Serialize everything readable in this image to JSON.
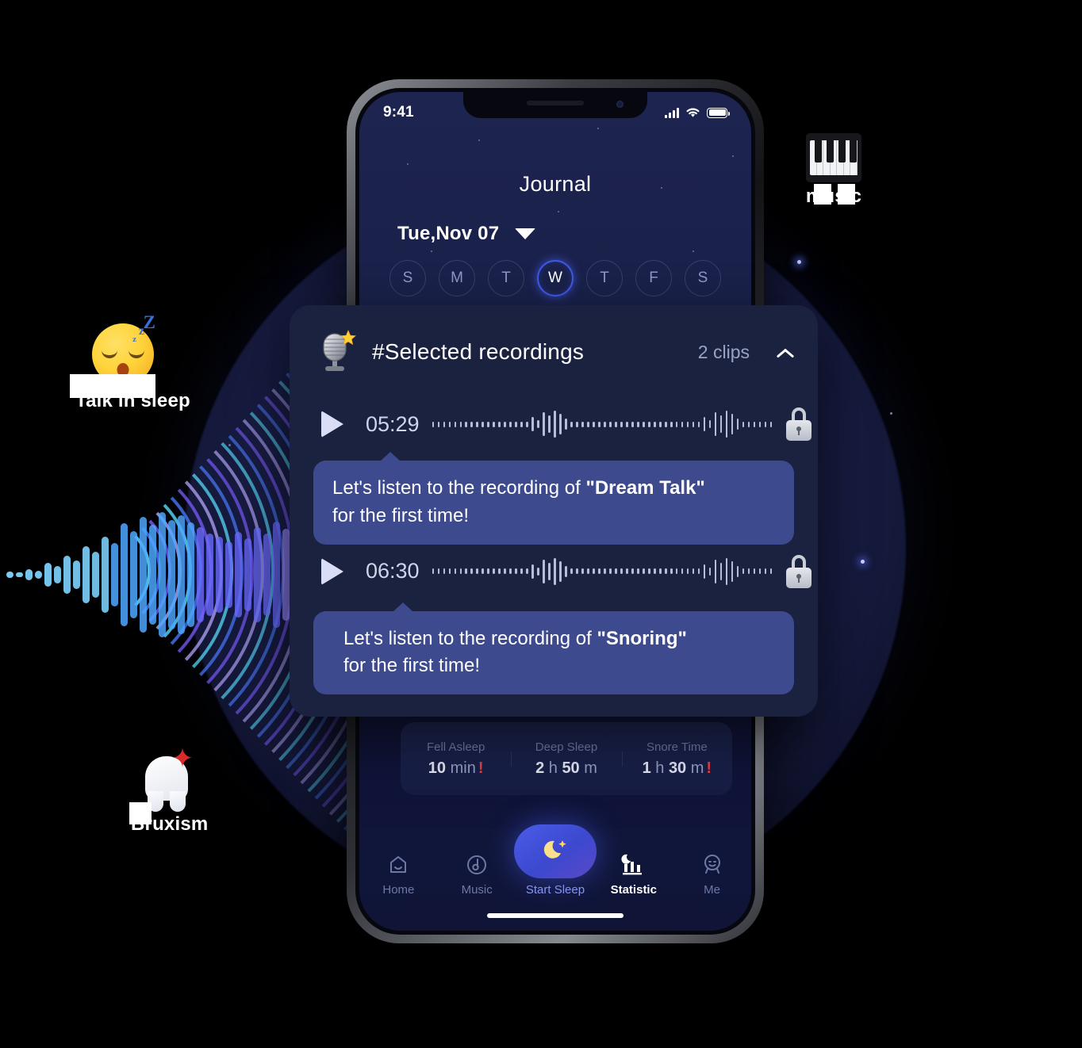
{
  "phone": {
    "status": {
      "time": "9:41",
      "signal_icon": "signal-bars-icon",
      "wifi_icon": "wifi-icon",
      "battery_icon": "battery-full-icon"
    },
    "header": {
      "title": "Journal"
    },
    "date": {
      "label": "Tue,Nov 07",
      "caret_icon": "chevron-down-icon"
    },
    "week": {
      "days": [
        {
          "letter": "S",
          "active": false
        },
        {
          "letter": "M",
          "active": false
        },
        {
          "letter": "T",
          "active": false
        },
        {
          "letter": "W",
          "active": true
        },
        {
          "letter": "T",
          "active": false
        },
        {
          "letter": "F",
          "active": false
        },
        {
          "letter": "S",
          "active": false
        }
      ],
      "active_color": "#4157e8"
    },
    "stats": [
      {
        "label": "Fell Asleep",
        "value_bold": "10",
        "value_unit": " min",
        "warn": "!"
      },
      {
        "label": "Deep Sleep",
        "value_bold": "2",
        "value_unit": " h ",
        "value_bold2": "50",
        "value_unit2": " m",
        "warn": ""
      },
      {
        "label": "Snore Time",
        "value_bold": "1",
        "value_unit": " h ",
        "value_bold2": "30",
        "value_unit2": " m",
        "warn": "!"
      }
    ],
    "tabs": [
      {
        "label": "Home",
        "icon": "home-icon",
        "state": "inactive"
      },
      {
        "label": "Music",
        "icon": "music-note-icon",
        "state": "inactive"
      },
      {
        "label": "Start Sleep",
        "icon": "crescent-moon-icon",
        "state": "primary"
      },
      {
        "label": "Statistic",
        "icon": "bar-chart-moon-icon",
        "state": "active"
      },
      {
        "label": "Me",
        "icon": "person-face-icon",
        "state": "inactive"
      }
    ]
  },
  "recordings_card": {
    "icon": "studio-microphone-icon",
    "title": "#Selected recordings",
    "clips_count": "2 clips",
    "collapse_icon": "chevron-up-icon",
    "accent_card_bg": "#1b2240",
    "bubble_bg": "#3d4a8e",
    "items": [
      {
        "duration": "05:29",
        "play_icon": "play-icon",
        "lock_icon": "lock-icon",
        "bubble_prefix": "Let's listen to the recording of ",
        "bubble_subject": "\"Dream Talk\"",
        "bubble_suffix": "for the first time!"
      },
      {
        "duration": "06:30",
        "play_icon": "play-icon",
        "lock_icon": "lock-icon",
        "bubble_prefix": "Let's listen to the recording of ",
        "bubble_subject": "\"Snoring\"",
        "bubble_suffix": "for the first time!"
      }
    ]
  },
  "floating_labels": [
    {
      "id": "sleep-talk",
      "emoji": "sleeping-face-icon",
      "text": "Talk in sleep"
    },
    {
      "id": "bruxism",
      "emoji": "tooth-icon",
      "text": "Bruxism"
    },
    {
      "id": "music",
      "emoji": "musical-keyboard-icon",
      "text": "music"
    }
  ],
  "decor": {
    "waveform_name": "audio-waveform-art",
    "glow_color": "#1a1f48",
    "wave_colors": [
      "#59e0ff",
      "#4b7bff",
      "#7b5cff",
      "#b7a9ff"
    ]
  }
}
